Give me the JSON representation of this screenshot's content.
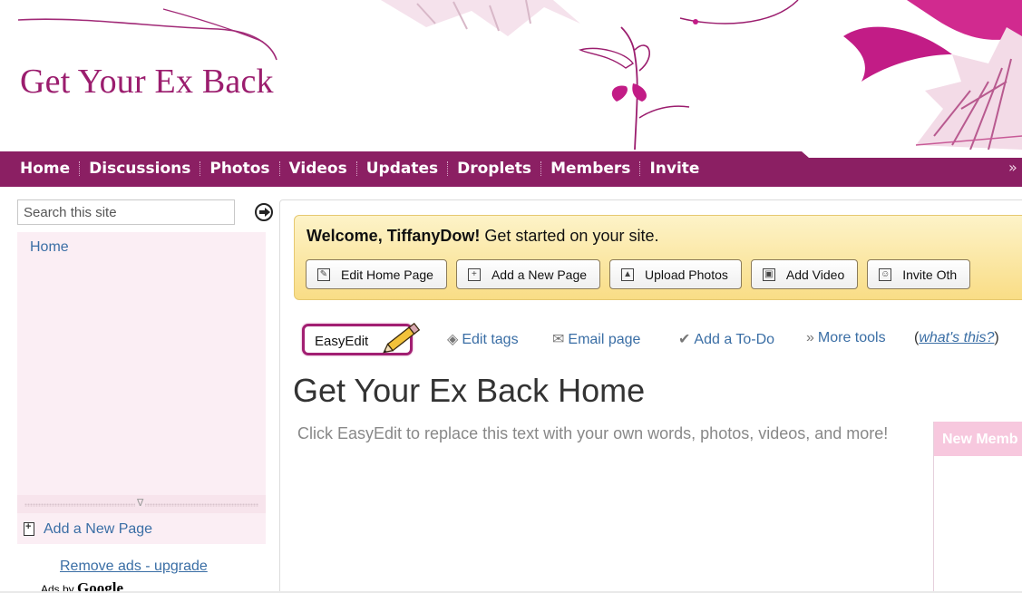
{
  "header": {
    "site_title": "Get Your Ex Back"
  },
  "nav": {
    "items": [
      "Home",
      "Discussions",
      "Photos",
      "Videos",
      "Updates",
      "Droplets",
      "Members",
      "Invite"
    ],
    "more_glyph": "»"
  },
  "sidebar": {
    "search_placeholder": "Search this site",
    "home_link": "Home",
    "add_page": "Add a New Page",
    "remove_ads": "Remove ads - upgrade",
    "ads_by": "Ads by",
    "ads_brand": "Google"
  },
  "welcome": {
    "greeting": "Welcome, TiffanyDow!",
    "message": " Get started on your site.",
    "buttons": [
      "Edit Home Page",
      "Add a New Page",
      "Upload Photos",
      "Add Video",
      "Invite Oth"
    ]
  },
  "toolbar": {
    "easyedit": "EasyEdit",
    "edit_tags": "Edit tags",
    "email_page": "Email page",
    "add_todo": "Add a To-Do",
    "more_tools": "More tools",
    "whats_this": "what's this?"
  },
  "main": {
    "heading": "Get Your Ex Back Home",
    "body": "Click EasyEdit to replace this text with your own words, photos, videos, and more!",
    "members_head": "New Memb"
  },
  "colors": {
    "brand": "#9b1d6e",
    "nav_bg": "#8b1f63",
    "link": "#3a6ea5"
  }
}
